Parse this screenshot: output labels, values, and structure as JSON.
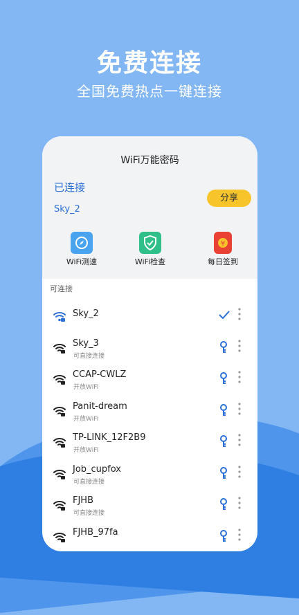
{
  "hero": {
    "title": "免费连接",
    "subtitle": "全国免费热点一键连接"
  },
  "app": {
    "title": "WiFi万能密码",
    "connected_label": "已连接",
    "connected_ssid": "Sky_2",
    "share_label": "分享",
    "tools": [
      {
        "label": "WiFi测速",
        "icon": "compass-icon",
        "color": "#4aa3ee"
      },
      {
        "label": "WiFi检查",
        "icon": "shield-check-icon",
        "color": "#2fc08a"
      },
      {
        "label": "每日签到",
        "icon": "red-envelope-icon",
        "color": "#e94234"
      }
    ],
    "section_label": "可连接",
    "networks": [
      {
        "ssid": "Sky_2",
        "status": "",
        "action": "check-icon"
      },
      {
        "ssid": "Sky_3",
        "status": "可直接连接",
        "action": "key-icon"
      },
      {
        "ssid": "CCAP-CWLZ",
        "status": "开放WiFi",
        "action": "key-icon"
      },
      {
        "ssid": "Panit-dream",
        "status": "开放WiFi",
        "action": "key-icon"
      },
      {
        "ssid": "TP-LINK_12F2B9",
        "status": "开放WiFi",
        "action": "key-icon"
      },
      {
        "ssid": "Job_cupfox",
        "status": "可直接连接",
        "action": "key-icon"
      },
      {
        "ssid": "FJHB",
        "status": "可直接连接",
        "action": "key-icon"
      },
      {
        "ssid": "FJHB_97fa",
        "status": "",
        "action": "key-icon"
      }
    ]
  },
  "colors": {
    "accent": "#2b6fd8",
    "share": "#f7c52b",
    "background": "#82b7f3"
  }
}
